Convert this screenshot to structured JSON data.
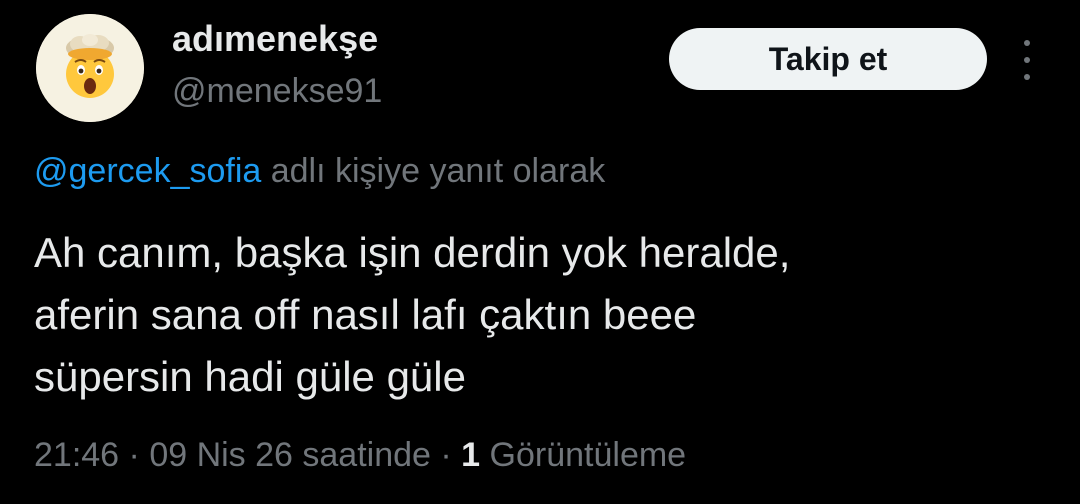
{
  "author": {
    "display_name": "adımenekşe",
    "handle": "@menekse91",
    "avatar_icon": "shocked-face-emoji-icon"
  },
  "follow_button": {
    "label": "Takip et"
  },
  "more_menu": {
    "icon": "more-vertical-icon"
  },
  "reply": {
    "mention": "@gercek_sofia",
    "suffix": " adlı kişiye yanıt olarak"
  },
  "tweet": {
    "lines": [
      "Ah canım, başka işin derdin yok heralde,",
      "aferin sana off nasıl lafı çaktın beee",
      "süpersin hadi güle güle"
    ]
  },
  "meta": {
    "time": "21:46",
    "separator": " · ",
    "date": "09 Nis 26 saatinde",
    "views_count": "1",
    "views_label": " Görüntüleme"
  },
  "colors": {
    "background": "#000000",
    "primary_text": "#e7e9ea",
    "secondary_text": "#71767b",
    "link": "#1d9bf0",
    "button_bg": "#eff3f4"
  }
}
